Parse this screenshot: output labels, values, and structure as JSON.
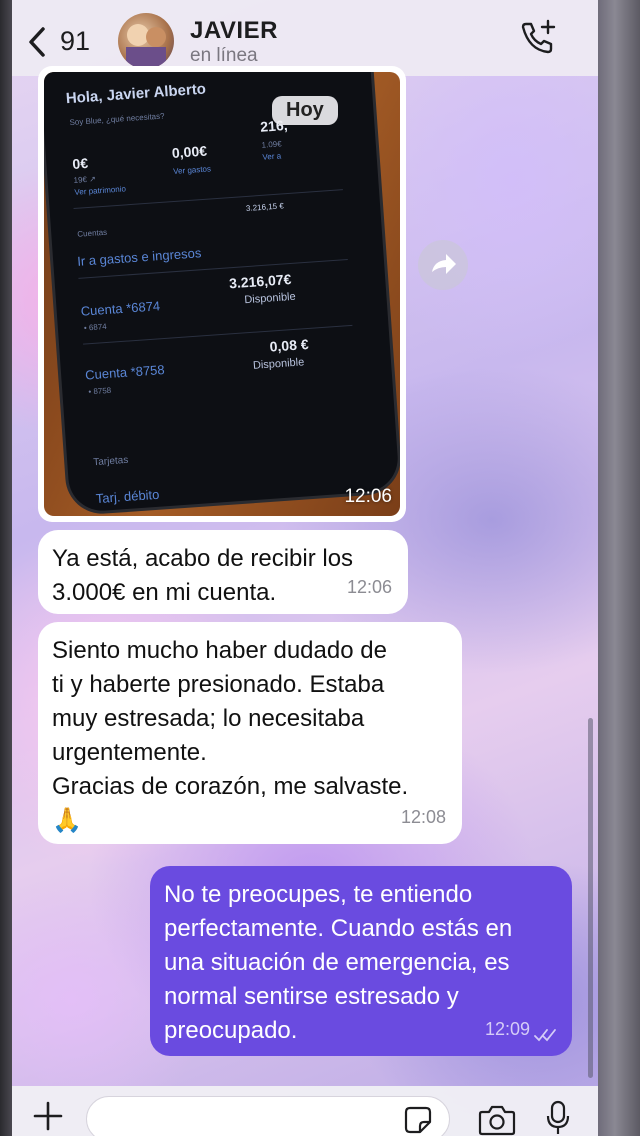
{
  "header": {
    "back_count": "91",
    "contact_name": "JAVIER",
    "contact_status": "en línea"
  },
  "image_message": {
    "date_chip": "Hoy",
    "time": "12:06",
    "phone_screen": {
      "greeting": "Hola, Javier Alberto",
      "subtitle": "Soy Blue, ¿qué necesitas?",
      "stat1_value": "0€",
      "stat1_sub": "19€ ↗",
      "stat1_link": "Ver patrimonio",
      "stat2_value": "0,00€",
      "stat2_link": "Ver gastos",
      "stat3_value": "216,",
      "stat3_sub": "1.09€",
      "stat3_link": "Ver a",
      "section_cuentas": "Cuentas",
      "cuentas_total": "3.216,15 €",
      "link_gastos": "Ir a gastos e ingresos",
      "account1_name": "Cuenta *6874",
      "account1_sub": "• 6874",
      "account1_amount": "3.216,07€",
      "account1_status": "Disponible",
      "account2_name": "Cuenta *8758",
      "account2_sub": "• 8758",
      "account2_amount": "0,08 €",
      "account2_status": "Disponible",
      "section_tarjetas": "Tarjetas",
      "card_name": "Tarj. débito"
    }
  },
  "messages": [
    {
      "direction": "incoming",
      "lines": [
        "Ya está, acabo de recibir los",
        "3.000€ en mi cuenta."
      ],
      "time": "12:06"
    },
    {
      "direction": "incoming",
      "lines": [
        "Siento mucho haber dudado de",
        "ti y haberte presionado. Estaba",
        "muy estresada; lo necesitaba",
        "urgentemente.",
        "Gracias de corazón, me salvaste.",
        "🙏"
      ],
      "time": "12:08"
    },
    {
      "direction": "outgoing",
      "lines": [
        "No te preocupes, te entiendo",
        "perfectamente. Cuando estás en",
        "una situación de emergencia, es",
        "normal sentirse estresado y",
        "preocupado."
      ],
      "time": "12:09",
      "read_status": "double-check-icon"
    }
  ],
  "colors": {
    "outgoing_bubble": "#6a4be0",
    "incoming_bubble": "#ffffff"
  }
}
